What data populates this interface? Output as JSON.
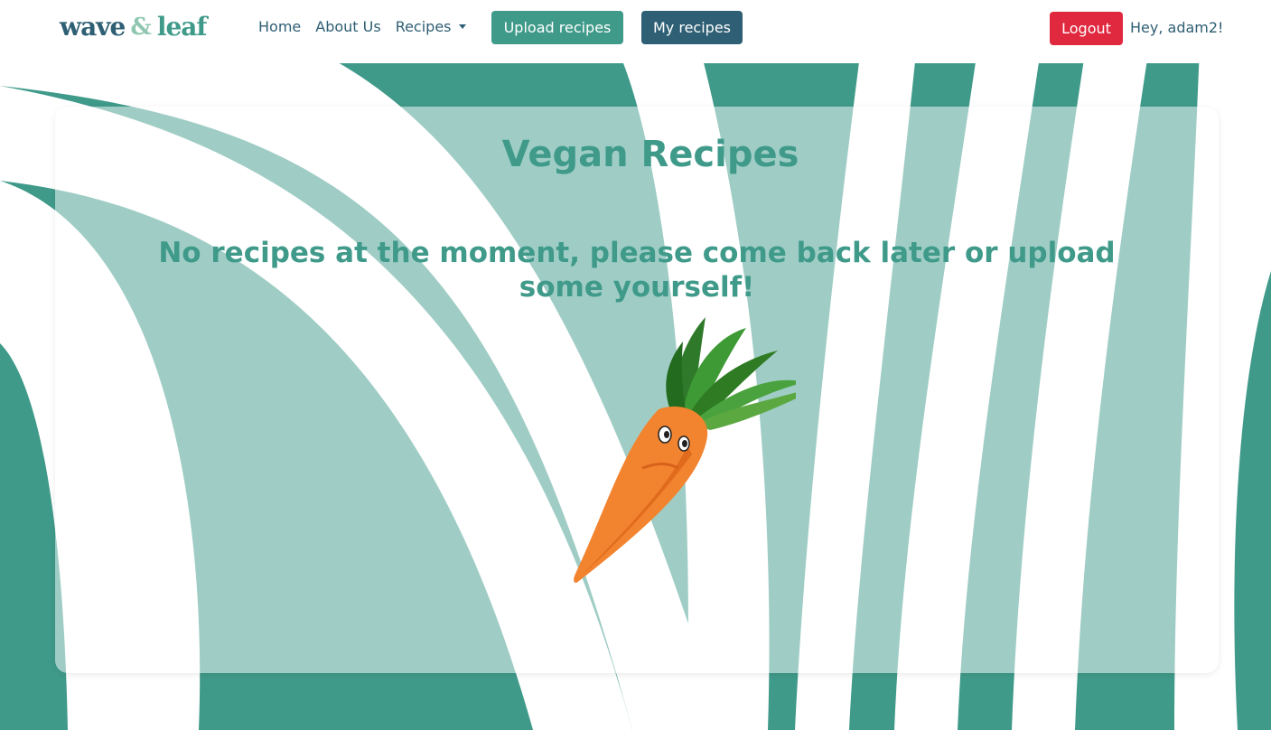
{
  "brand": {
    "word_left": "wave",
    "ampersand": "&",
    "word_right": "leaf"
  },
  "nav": {
    "home": "Home",
    "about": "About Us",
    "recipes": "Recipes",
    "upload": "Upload recipes",
    "my_recipes": "My recipes",
    "logout": "Logout",
    "greeting": "Hey, adam2!"
  },
  "main": {
    "title": "Vegan Recipes",
    "empty_message": "No recipes at the moment, please come back later or upload some yourself!"
  },
  "icons": {
    "illustration": "carrot-illustration",
    "dropdown": "chevron-down-icon"
  },
  "colors": {
    "teal": "#3f9a8a",
    "teal_light": "#d6e9e6",
    "navy": "#2f5f74",
    "logout_red": "#e0283e"
  }
}
